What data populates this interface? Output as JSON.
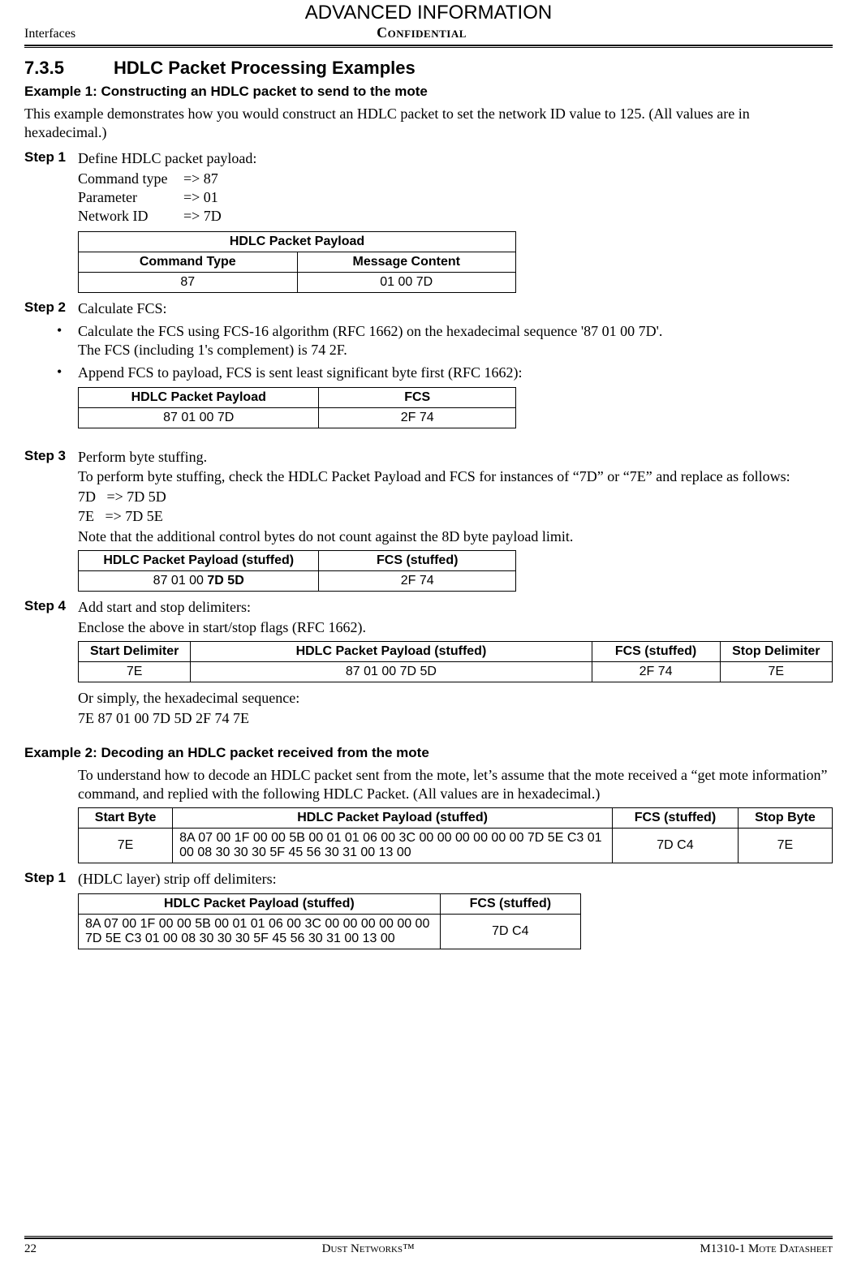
{
  "header": {
    "advanced": "ADVANCED INFORMATION",
    "left": "Interfaces",
    "confidential": "Confidential"
  },
  "section": {
    "num": "7.3.5",
    "title": "HDLC Packet Processing Examples"
  },
  "ex1": {
    "title": "Example 1: Constructing an HDLC packet to send to the mote",
    "intro": "This example demonstrates how you would construct an HDLC packet to set the network ID value to 125. (All values are in hexadecimal.)",
    "step1": {
      "label": "Step 1",
      "text": "Define HDLC packet payload:",
      "kv": [
        {
          "k": "Command type",
          "v": "=> 87"
        },
        {
          "k": "Parameter",
          "v": "=> 01"
        },
        {
          "k": "Network ID",
          "v": "=> 7D"
        }
      ],
      "table": {
        "top": "HDLC Packet Payload",
        "h1": "Command Type",
        "h2": "Message Content",
        "c1": "87",
        "c2": "01 00 7D"
      }
    },
    "step2": {
      "label": "Step 2",
      "text": "Calculate FCS:",
      "b1a": "Calculate the FCS using FCS-16 algorithm (RFC 1662) on the hexadecimal sequence '87 01 00 7D'.",
      "b1b": "The FCS (including 1's complement) is 74 2F.",
      "b2": "Append FCS to payload, FCS is sent least significant byte first (RFC 1662):",
      "table": {
        "h1": "HDLC Packet Payload",
        "h2": "FCS",
        "c1": "87 01 00 7D",
        "c2": "2F 74"
      }
    },
    "step3": {
      "label": "Step 3",
      "text": "Perform byte stuffing.",
      "p1": "To perform byte stuffing, check the HDLC Packet Payload and FCS for instances of “7D” or “7E” and replace as follows:",
      "r1": "7D   => 7D 5D",
      "r2": "7E   => 7D 5E",
      "note": "Note that the additional control bytes do not count against the 8D byte payload limit.",
      "table": {
        "h1": "HDLC Packet Payload (stuffed)",
        "h2": "FCS (stuffed)",
        "c1_pre": "87 01 00 ",
        "c1_bold": "7D 5D",
        "c2": "2F 74"
      }
    },
    "step4": {
      "label": "Step 4",
      "text": "Add start and stop delimiters:",
      "p1": "Enclose the above in start/stop flags (RFC 1662).",
      "table": {
        "h1": "Start Delimiter",
        "h2": "HDLC Packet Payload (stuffed)",
        "h3": "FCS (stuffed)",
        "h4": "Stop Delimiter",
        "c1": "7E",
        "c2": "87 01 00 7D 5D",
        "c3": "2F 74",
        "c4": "7E"
      },
      "p2": "Or simply, the hexadecimal sequence:",
      "seq": "7E 87 01 00 7D 5D 2F 74 7E"
    }
  },
  "ex2": {
    "title": "Example 2: Decoding an HDLC packet received from the mote",
    "intro": "To understand how to decode an HDLC packet sent from the mote, let’s assume that the mote received a “get mote information” command, and replied with the following HDLC Packet. (All values are in hexadecimal.)",
    "table0": {
      "h1": "Start Byte",
      "h2": "HDLC Packet Payload (stuffed)",
      "h3": "FCS (stuffed)",
      "h4": "Stop Byte",
      "c1": "7E",
      "c2": "8A 07 00 1F 00 00 5B 00 01 01 06 00 3C 00 00 00 00 00 00 7D 5E C3 01 00 08 30 30 30 5F 45 56 30 31 00 13 00",
      "c3": "7D C4",
      "c4": "7E"
    },
    "step1": {
      "label": "Step 1",
      "text": "(HDLC layer) strip off delimiters:",
      "table": {
        "h1": "HDLC Packet Payload (stuffed)",
        "h2": "FCS (stuffed)",
        "c1": "8A 07 00 1F 00 00 5B 00 01 01 06 00 3C 00 00 00 00 00 00 7D 5E C3 01 00 08 30 30 30 5F 45 56 30 31 00 13 00",
        "c2": "7D C4"
      }
    }
  },
  "footer": {
    "page": "22",
    "mid": "Dust Networks™",
    "right": "M1310-1 Mote Datasheet"
  }
}
